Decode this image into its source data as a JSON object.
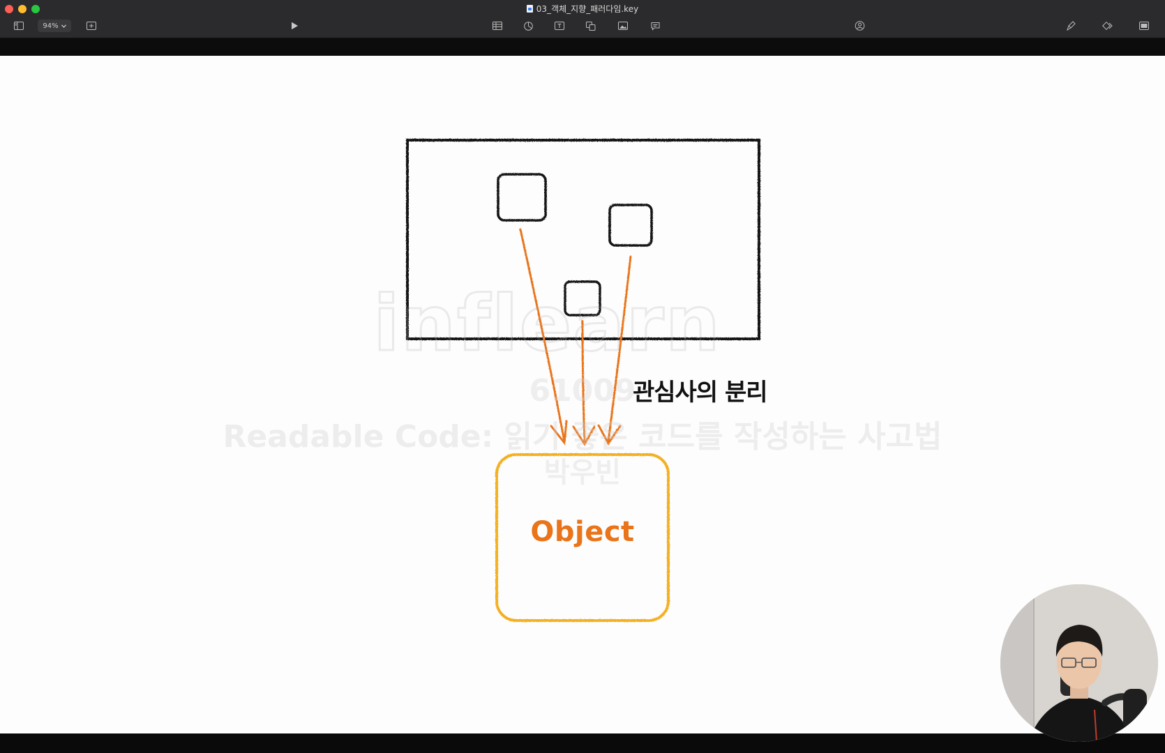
{
  "window": {
    "title": "03_객체_지향_패러다임.key",
    "zoom": "94%"
  },
  "toolbar": {
    "icons": [
      "sidebar-icon",
      "add-slide-icon",
      "play-icon",
      "table-icon",
      "chart-icon",
      "text-icon",
      "shape-icon",
      "media-icon",
      "comment-icon",
      "collaborate-icon",
      "format-brush-icon",
      "animate-icon",
      "document-icon"
    ]
  },
  "slide": {
    "concern_label": "관심사의 분리",
    "object_label": "Object",
    "colors": {
      "sketch_line": "#141414",
      "arrow": "#e9741a",
      "object_box": "#f3b021",
      "object_text": "#e9741a"
    }
  },
  "watermark": {
    "logo": "inflearn",
    "id": "61009",
    "course": "Readable Code: 읽기 좋은 코드를 작성하는 사고법",
    "author": "박우빈"
  },
  "webcam": {
    "icon": "presenter-webcam"
  }
}
